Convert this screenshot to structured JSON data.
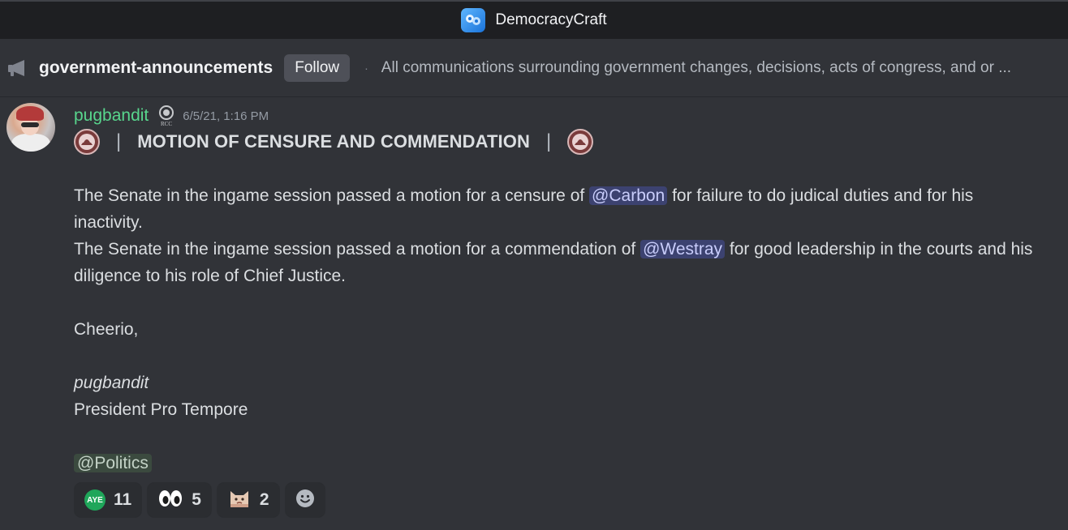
{
  "app": {
    "server_name": "DemocracyCraft"
  },
  "channel": {
    "name": "government-announcements",
    "follow_label": "Follow",
    "separator": "·",
    "topic": "All communications surrounding government changes, decisions, acts of congress, and or ..."
  },
  "message": {
    "author": "pugbandit",
    "author_color": "#58d68d",
    "role_badge_text": "RCC",
    "timestamp": "6/5/21, 1:16 PM",
    "title": "MOTION OF CENSURE AND COMMENDATION",
    "title_pipe": "|",
    "line1_pre": "The Senate in the ingame session passed a motion for a censure of ",
    "line1_mention": "@Carbon",
    "line1_post": " for failure to do judical duties and for his inactivity.",
    "line2_pre": "The Senate in the ingame session passed a motion for a commendation of ",
    "line2_mention": "@Westray",
    "line2_post": " for good leadership in the courts and his diligence to his role of Chief Justice.",
    "greeting": "Cheerio,",
    "signature_name": "pugbandit",
    "signature_title": "President Pro Tempore",
    "role_mention": "@Politics"
  },
  "reactions": [
    {
      "emoji": "aye-emoji",
      "emoji_text": "AYE",
      "count": "11"
    },
    {
      "emoji": "eyes-emoji",
      "count": "5"
    },
    {
      "emoji": "cat-emoji",
      "count": "2"
    }
  ],
  "colors": {
    "background": "#313338",
    "mention_bg": "#3c4270",
    "aye_green": "#1fa65a"
  }
}
